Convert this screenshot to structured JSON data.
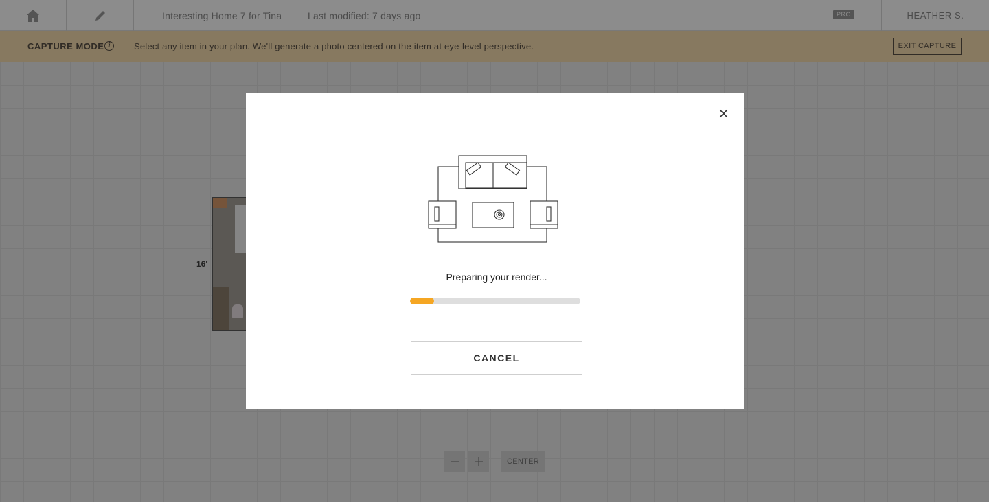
{
  "topbar": {
    "home_icon": "home-icon",
    "edit_icon": "pencil-icon",
    "plan_title": "Interesting Home 7 for Tina",
    "last_modified": "Last modified: 7 days ago",
    "pro_badge": "PRO",
    "user_name": "HEATHER S."
  },
  "capture_bar": {
    "title": "CAPTURE MODE",
    "info_icon": "info-icon",
    "message": "Select any item in your plan. We'll generate a photo centered on the item at eye-level perspective.",
    "exit_label": "EXIT CAPTURE",
    "background_color": "#f6dcb0"
  },
  "canvas": {
    "dimension_label": "16'",
    "zoom_out_icon": "minus-icon",
    "zoom_in_icon": "plus-icon",
    "center_label": "CENTER"
  },
  "modal": {
    "close_icon": "close-icon",
    "illustration_icon": "living-room-layout-icon",
    "status_text": "Preparing your render...",
    "progress": 0.14,
    "progress_color": "#f5a623",
    "cancel_label": "CANCEL"
  }
}
